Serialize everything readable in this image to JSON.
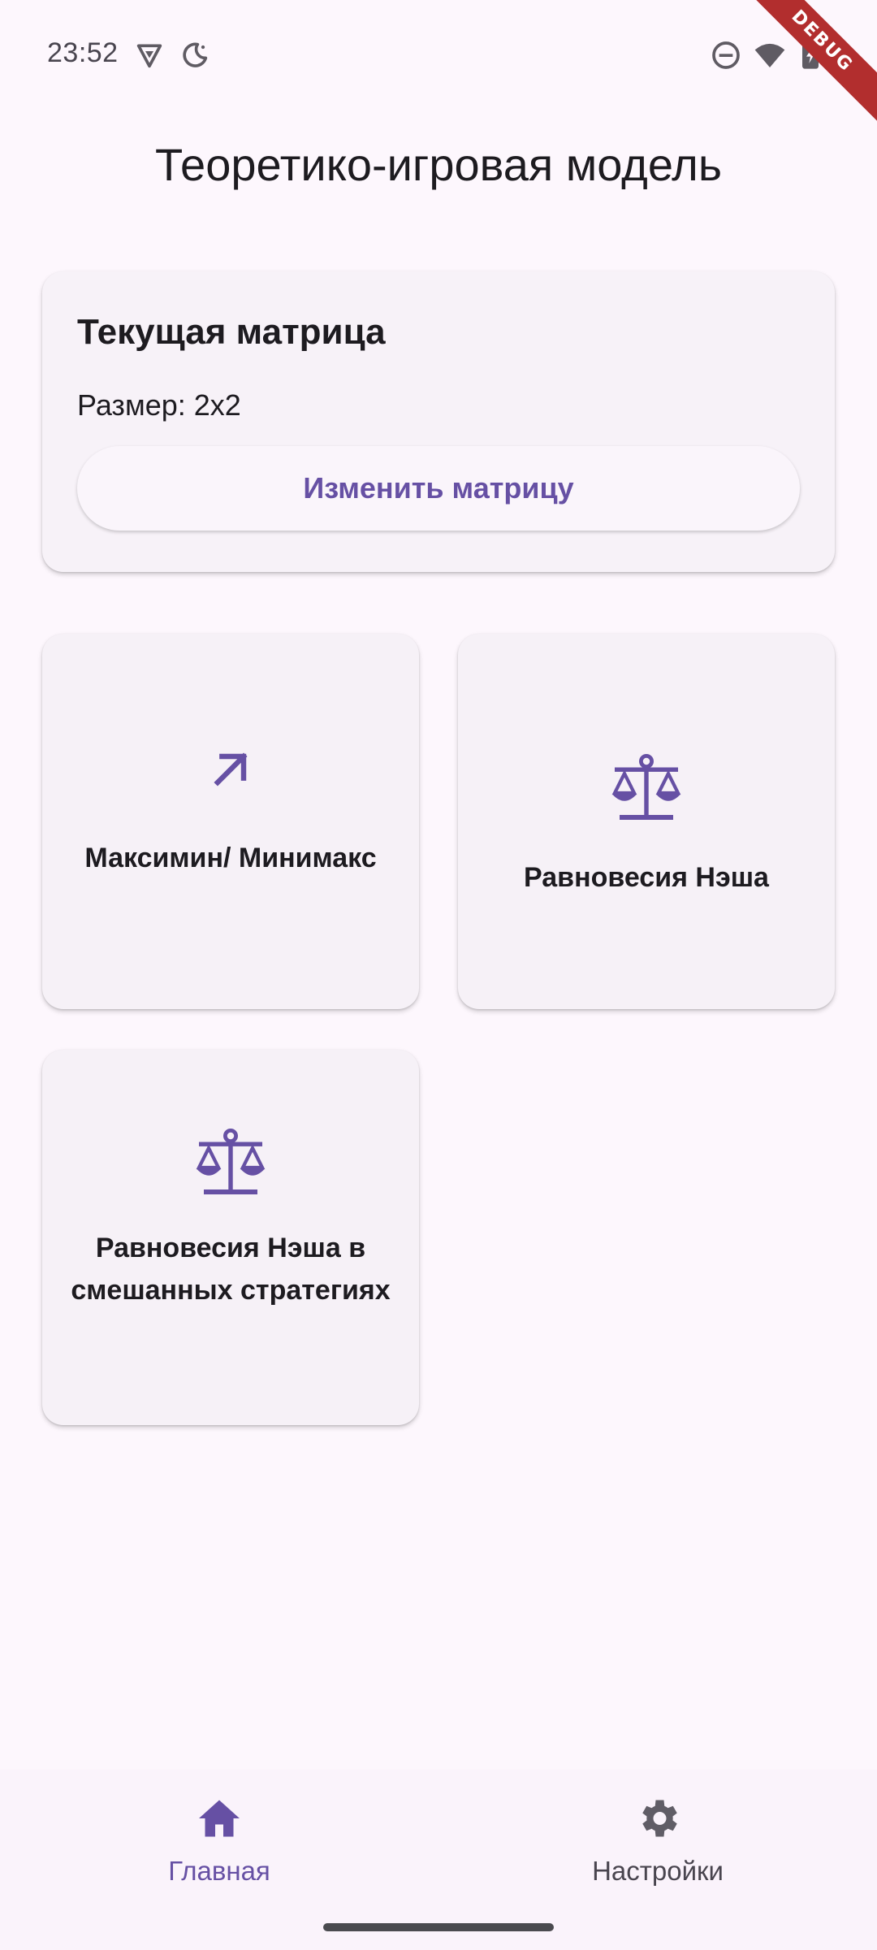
{
  "status_bar": {
    "time": "23:52"
  },
  "debug_banner": "DEBUG",
  "app": {
    "title": "Теоретико-игровая модель"
  },
  "matrix_card": {
    "title": "Текущая матрица",
    "size_text": "Размер: 2x2",
    "edit_button": "Изменить матрицу"
  },
  "tiles": [
    {
      "label": "Максимин/ Минимакс",
      "icon": "arrow-up-right-icon"
    },
    {
      "label": "Равновесия Нэша",
      "icon": "balance-scale-icon"
    },
    {
      "label": "Равновесия Нэша в смешанных стратегиях",
      "icon": "balance-scale-icon"
    }
  ],
  "bottom_nav": {
    "items": [
      {
        "label": "Главная",
        "icon": "home-icon",
        "active": true
      },
      {
        "label": "Настройки",
        "icon": "gear-icon",
        "active": false
      }
    ]
  },
  "colors": {
    "accent": "#6650A4",
    "background": "#FDF7FD",
    "card": "#F6F1F7",
    "text": "#1D1B20"
  }
}
